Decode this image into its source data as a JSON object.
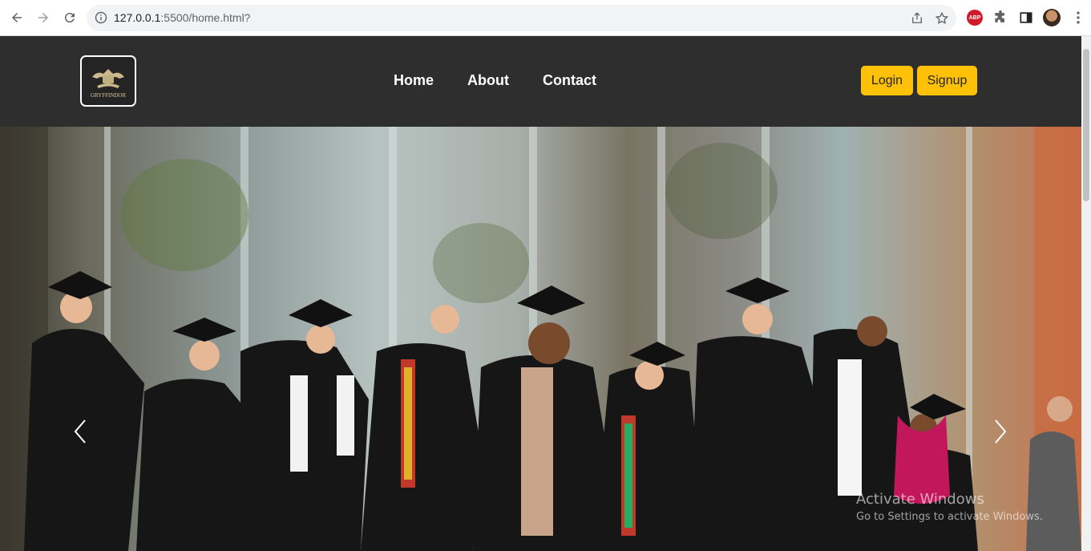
{
  "browser": {
    "url_host": "127.0.0.1",
    "url_path": ":5500/home.html?",
    "extension_badge": "ABP"
  },
  "navbar": {
    "logo_text": "GRYFFINDOR",
    "menu": [
      "Home",
      "About",
      "Contact"
    ],
    "login_label": "Login",
    "signup_label": "Signup",
    "bg_color": "#2e2e2e",
    "button_color": "#ffc107"
  },
  "hero": {
    "image_description": "graduates-celebrating-photo",
    "prev_icon": "chevron-left-icon",
    "next_icon": "chevron-right-icon"
  },
  "watermark": {
    "line1": "Activate Windows",
    "line2": "Go to Settings to activate Windows."
  }
}
